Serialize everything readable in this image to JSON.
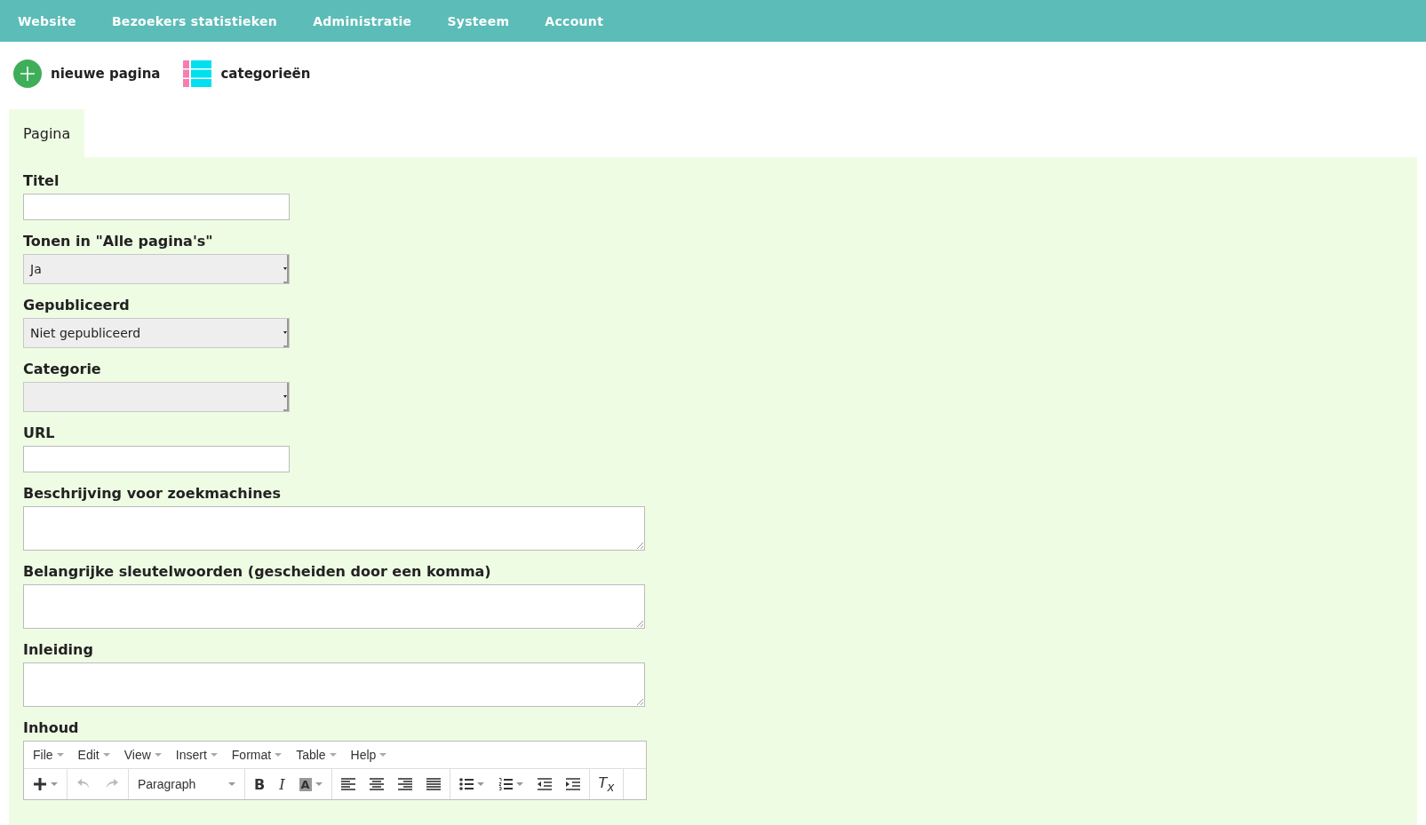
{
  "nav": [
    {
      "label": "Website"
    },
    {
      "label": "Bezoekers statistieken"
    },
    {
      "label": "Administratie"
    },
    {
      "label": "Systeem"
    },
    {
      "label": "Account"
    }
  ],
  "actions": [
    {
      "kind": "add",
      "label": "nieuwe pagina"
    },
    {
      "kind": "list",
      "label": "categorieën"
    }
  ],
  "tabs": [
    {
      "label": "Pagina",
      "selected": true
    }
  ],
  "fields": [
    {
      "kind": "text",
      "label": "Titel"
    },
    {
      "kind": "select",
      "label": "Tonen in \"Alle pagina's\"",
      "value": "Ja"
    },
    {
      "kind": "select",
      "label": "Gepubliceerd",
      "value": "Niet gepubliceerd"
    },
    {
      "kind": "select",
      "label": "Categorie"
    },
    {
      "kind": "text",
      "label": "URL"
    },
    {
      "kind": "textarea",
      "label": "Beschrijving voor zoekmachines"
    },
    {
      "kind": "textarea",
      "label": "Belangrijke sleutelwoorden (gescheiden door een komma)"
    },
    {
      "kind": "textarea",
      "label": "Inleiding"
    },
    {
      "kind": "editor",
      "label": "Inhoud"
    }
  ],
  "editor": {
    "menus": [
      {
        "label": "File"
      },
      {
        "label": "Edit"
      },
      {
        "label": "View"
      },
      {
        "label": "Insert"
      },
      {
        "label": "Format"
      },
      {
        "label": "Table"
      },
      {
        "label": "Help"
      }
    ],
    "toolbar": [
      [
        {
          "kind": "plus",
          "caret": true
        }
      ],
      [
        {
          "kind": "undo",
          "disabled": true
        },
        {
          "kind": "redo",
          "disabled": true
        }
      ],
      [
        {
          "kind": "select",
          "value": "Paragraph"
        }
      ],
      [
        {
          "kind": "bold",
          "text": "B"
        },
        {
          "kind": "italic",
          "text": "I"
        },
        {
          "kind": "backcolor",
          "text": "A",
          "caret": true
        }
      ],
      [
        {
          "kind": "align-left"
        },
        {
          "kind": "align-center"
        },
        {
          "kind": "align-right"
        },
        {
          "kind": "justify"
        }
      ],
      [
        {
          "kind": "bullets",
          "caret": true
        },
        {
          "kind": "numbers",
          "caret": true
        },
        {
          "kind": "outdent"
        },
        {
          "kind": "indent"
        }
      ],
      [
        {
          "kind": "clear",
          "text": "T$_{x}$"
        }
      ]
    ]
  }
}
